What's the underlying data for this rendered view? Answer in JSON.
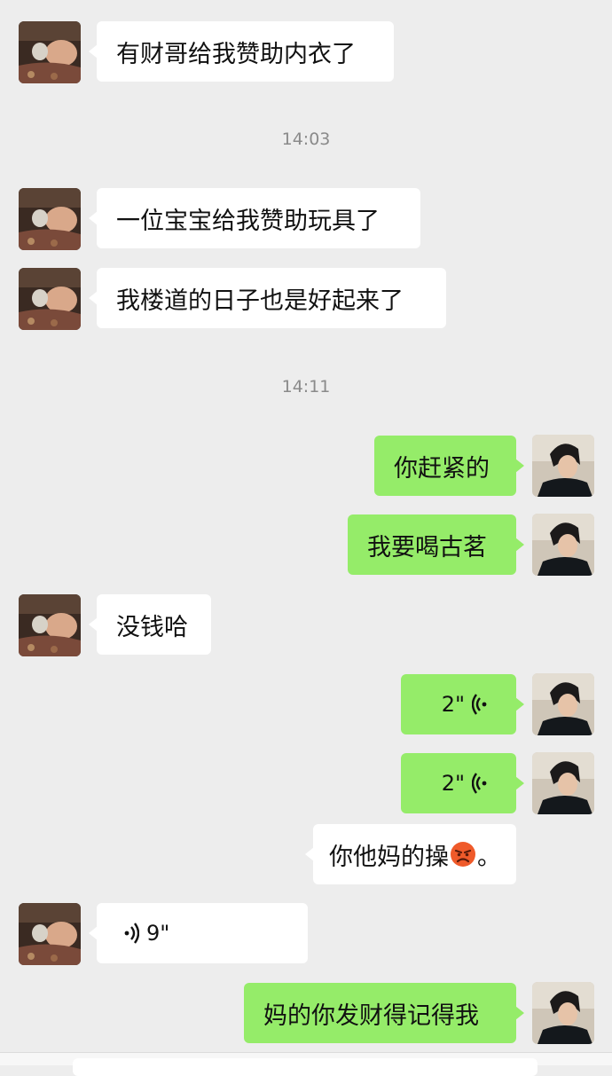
{
  "colors": {
    "background": "#ededed",
    "incoming_bubble": "#ffffff",
    "outgoing_bubble": "#95ec69",
    "timestamp_text": "#8a8a8a"
  },
  "messages": [
    {
      "type": "in",
      "text": "有财哥给我赞助内衣了"
    },
    {
      "type": "time",
      "text": "14:03"
    },
    {
      "type": "in",
      "text": "一位宝宝给我赞助玩具了"
    },
    {
      "type": "in",
      "text": "我楼道的日子也是好起来了"
    },
    {
      "type": "time",
      "text": "14:11"
    },
    {
      "type": "out",
      "text": "你赶紧的"
    },
    {
      "type": "out",
      "text": "我要喝古茗"
    },
    {
      "type": "in",
      "text": "没钱哈"
    },
    {
      "type": "out-voice",
      "duration": "2\""
    },
    {
      "type": "out-voice",
      "duration": "2\""
    },
    {
      "type": "out-plain",
      "text_before": "你他妈的操",
      "emoji": "angry-face-icon",
      "text_after": "。"
    },
    {
      "type": "in-voice",
      "duration": "9\""
    },
    {
      "type": "out",
      "text": "妈的你发财得记得我"
    }
  ]
}
